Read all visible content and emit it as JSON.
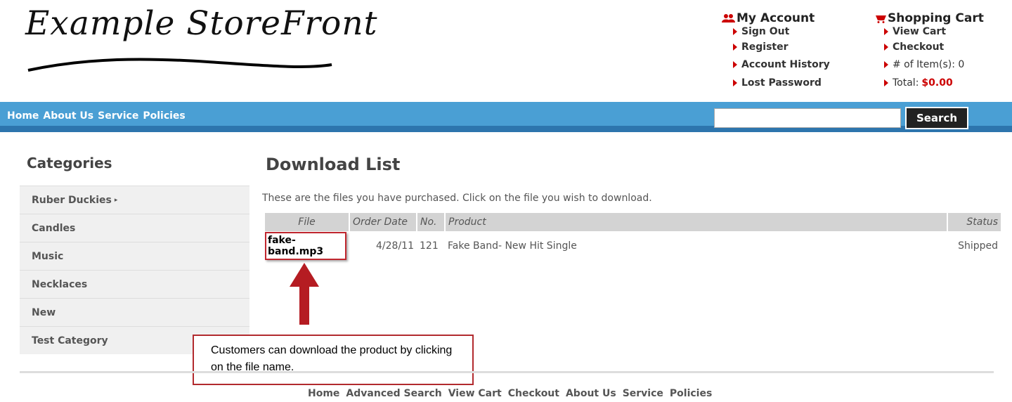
{
  "logo": {
    "text": "Example StoreFront"
  },
  "account": {
    "heading": "My Account",
    "links": [
      "Sign Out",
      "Register",
      "Account History",
      "Lost Password"
    ]
  },
  "cart": {
    "heading": "Shopping Cart",
    "links": [
      "View Cart",
      "Checkout"
    ],
    "items_label": "# of Item(s): 0",
    "total_label": "Total:",
    "total_value": "$0.00"
  },
  "nav": {
    "links": [
      "Home",
      "About Us",
      "Service",
      "Policies"
    ],
    "search_button": "Search",
    "search_value": ""
  },
  "sidebar": {
    "title": "Categories",
    "items": [
      "Ruber Duckies",
      "Candles",
      "Music",
      "Necklaces",
      "New",
      "Test Category"
    ]
  },
  "main": {
    "title": "Download List",
    "intro": "These are the files you have purchased. Click on the file you wish to download.",
    "columns": [
      "File",
      "Order Date",
      "No.",
      "Product",
      "Status"
    ],
    "rows": [
      {
        "file": "fake-band.mp3",
        "order_date": "4/28/11",
        "no": "121",
        "product": "Fake Band- New Hit Single",
        "status": "Shipped"
      }
    ]
  },
  "annotation": {
    "text": "Customers can download the product by clicking on the file name."
  },
  "footer": {
    "links": [
      "Home",
      "Advanced Search",
      "View Cart",
      "Checkout",
      "About Us",
      "Service",
      "Policies"
    ]
  },
  "colors": {
    "nav_bg": "#4a9fd4",
    "nav_border": "#2d75ad",
    "accent_red": "#c00000",
    "annotation_red": "#b22a2e"
  }
}
